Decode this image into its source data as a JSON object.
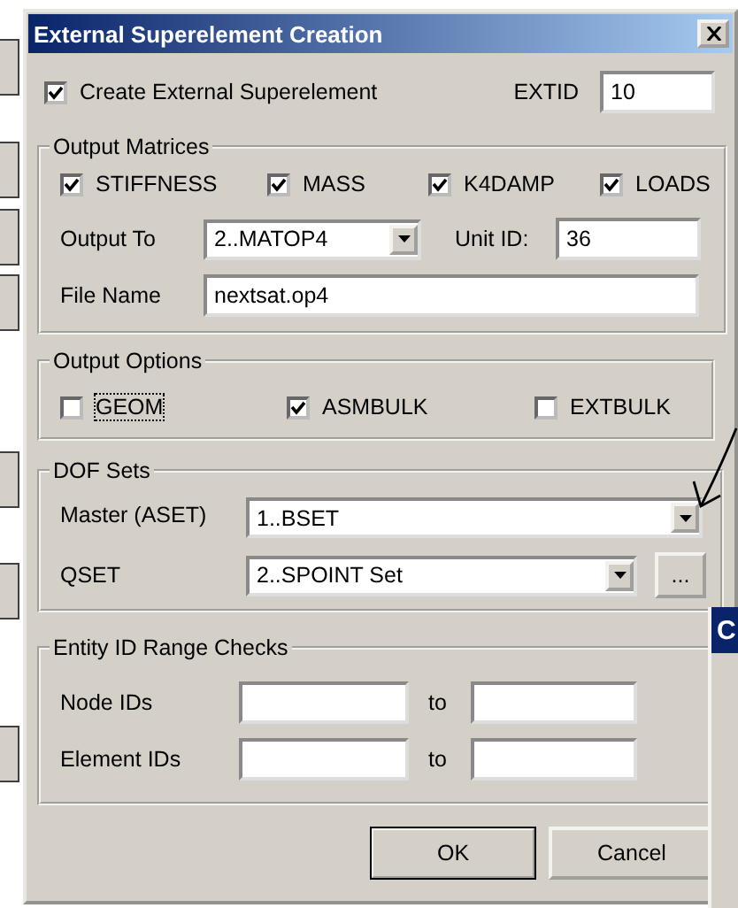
{
  "window": {
    "title": "External Superelement Creation"
  },
  "create": {
    "label": "Create External Superelement",
    "checked": true
  },
  "extid": {
    "label": "EXTID",
    "value": "10"
  },
  "output_matrices": {
    "title": "Output Matrices",
    "options": [
      {
        "label": "STIFFNESS",
        "checked": true
      },
      {
        "label": "MASS",
        "checked": true
      },
      {
        "label": "K4DAMP",
        "checked": true
      },
      {
        "label": "LOADS",
        "checked": true
      }
    ],
    "output_to": {
      "label": "Output To",
      "value": "2..MATOP4"
    },
    "unit_id": {
      "label": "Unit ID:",
      "value": "36"
    },
    "file_name": {
      "label": "File Name",
      "value": "nextsat.op4"
    }
  },
  "output_options": {
    "title": "Output Options",
    "options": [
      {
        "label": "GEOM",
        "checked": false,
        "focused": true
      },
      {
        "label": "ASMBULK",
        "checked": true,
        "focused": false
      },
      {
        "label": "EXTBULK",
        "checked": false,
        "focused": false
      }
    ]
  },
  "dof_sets": {
    "title": "DOF Sets",
    "master": {
      "label": "Master (ASET)",
      "value": "1..BSET"
    },
    "qset": {
      "label": "QSET",
      "value": "2..SPOINT Set",
      "button": "..."
    }
  },
  "entity_ranges": {
    "title": "Entity ID Range Checks",
    "rows": [
      {
        "label": "Node IDs",
        "to": "to"
      },
      {
        "label": "Element IDs",
        "to": "to"
      }
    ]
  },
  "buttons": [
    {
      "label": "OK",
      "default": true
    },
    {
      "label": "Cancel",
      "default": false
    }
  ],
  "background_window": {
    "title": "C"
  }
}
